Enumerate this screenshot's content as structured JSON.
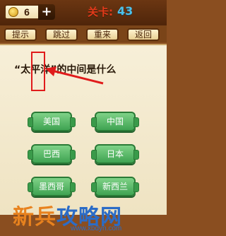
{
  "header": {
    "coins": "6",
    "add_label": "+",
    "level_label": "关卡:",
    "level_number": "43"
  },
  "toolbar": {
    "hint": "提示",
    "skip": "跳过",
    "restart": "重来",
    "back": "返回"
  },
  "question": {
    "text": "“太平洋”的中间是什么"
  },
  "answers": [
    "美国",
    "中国",
    "巴西",
    "日本",
    "墨西哥",
    "新西兰"
  ],
  "watermark": {
    "title_part1": "新",
    "title_part2": "兵",
    "title_part3": "攻略网",
    "url": "www.xbdyn.com"
  },
  "colors": {
    "level_red": "#e23a1a",
    "level_blue": "#4ec1e9",
    "answer_green": "#3fa352",
    "highlight_red": "#e01b1b"
  }
}
